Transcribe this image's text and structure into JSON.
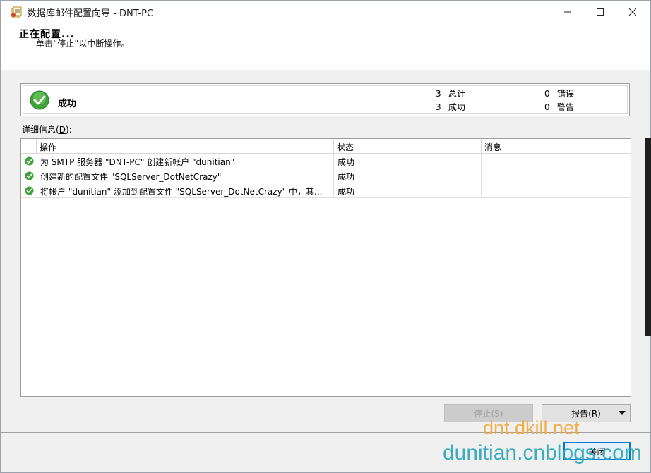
{
  "window": {
    "title": "数据库邮件配置向导 - DNT-PC",
    "icon": "wizard-app-icon",
    "controls": {
      "minimize": "minimize-icon",
      "maximize": "maximize-icon",
      "close": "close-icon"
    }
  },
  "header": {
    "title": "正在配置...",
    "subtitle": "单击“停止”以中断操作。"
  },
  "summary": {
    "status": "成功",
    "total_count": "3",
    "total_label": "总计",
    "success_count": "3",
    "success_label": "成功",
    "error_count": "0",
    "error_label": "错误",
    "warning_count": "0",
    "warning_label": "警告"
  },
  "details": {
    "label_prefix": "详细信息(",
    "label_mnemonic": "D",
    "label_suffix": "):",
    "columns": [
      "操作",
      "状态",
      "消息"
    ],
    "rows": [
      {
        "action": "为 SMTP 服务器 \"DNT-PC\" 创建新帐户 \"dunitian\"",
        "status": "成功",
        "message": ""
      },
      {
        "action": "创建新的配置文件 \"SQLServer_DotNetCrazy\"",
        "status": "成功",
        "message": ""
      },
      {
        "action": "将帐户 \"dunitian\" 添加到配置文件 \"SQLServer_DotNetCrazy\" 中，其...",
        "status": "成功",
        "message": ""
      }
    ]
  },
  "buttons": {
    "stop": "停止(S)",
    "report": "报告(R)",
    "close": "关闭"
  },
  "watermark": {
    "line1": "dnt.dkill.net",
    "line2": "dunitian.cnblogs.com"
  },
  "colors": {
    "success_green": "#3fa33a",
    "accent_blue": "#0078d7"
  }
}
